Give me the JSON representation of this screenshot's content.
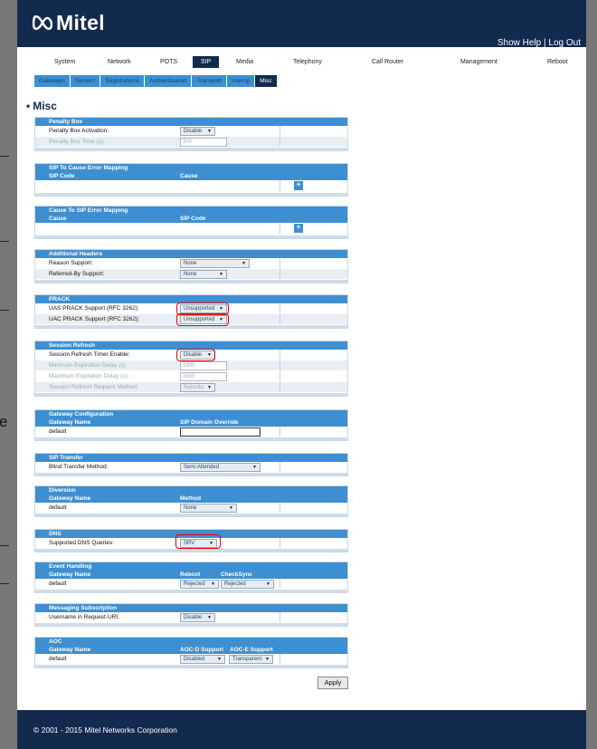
{
  "header": {
    "logo_text": "Mitel",
    "show_help": "Show Help",
    "separator": "|",
    "log_out": "Log Out"
  },
  "nav": {
    "items": [
      "System",
      "Network",
      "POTS",
      "SIP",
      "Media",
      "Telephony",
      "Call Router",
      "Management",
      "Reboot"
    ],
    "active": "SIP"
  },
  "subnav": {
    "items": [
      "Gateways",
      "Servers",
      "Registrations",
      "Authentication",
      "Transport",
      "Interop",
      "Misc"
    ],
    "active": "Misc"
  },
  "page_title": "Misc",
  "sections": {
    "penalty_box": {
      "title": "Penalty Box",
      "activation_label": "Penalty Box Activation:",
      "activation_value": "Disable",
      "time_label": "Penalty Box Time (s):",
      "time_value": "300"
    },
    "sip_to_cause": {
      "title": "SIP To Cause Error Mapping",
      "col1": "SIP Code",
      "col2": "Cause"
    },
    "cause_to_sip": {
      "title": "Cause To SIP Error Mapping",
      "col1": "Cause",
      "col2": "SIP Code"
    },
    "additional_headers": {
      "title": "Additional Headers",
      "reason_label": "Reason Support:",
      "reason_value": "None",
      "referred_label": "Referred-By Support:",
      "referred_value": "None"
    },
    "prack": {
      "title": "PRACK",
      "uas_label": "UAS PRACK Support (RFC 3262):",
      "uas_value": "Unsupported",
      "uac_label": "UAC PRACK Support (RFC 3262):",
      "uac_value": "Unsupported"
    },
    "session_refresh": {
      "title": "Session Refresh",
      "timer_label": "Session Refresh Timer Enable:",
      "timer_value": "Disable",
      "min_label": "Minimum Expiration Delay (s):",
      "min_value": "1800",
      "max_label": "Maximum Expiration Delay (s):",
      "max_value": "3600",
      "method_label": "Session Refresh Request Method:",
      "method_value": "ReInvite"
    },
    "gateway_config": {
      "title": "Gateway Configuration",
      "col1": "Gateway Name",
      "col2": "SIP Domain Override",
      "row_name": "default",
      "row_value": ""
    },
    "sip_transfer": {
      "title": "SIP Transfer",
      "blind_label": "Blind Transfer Method:",
      "blind_value": "Semi Attended"
    },
    "diversion": {
      "title": "Diversion",
      "col1": "Gateway Name",
      "col2": "Method",
      "row_name": "default",
      "row_value": "None"
    },
    "dns": {
      "title": "DNS",
      "queries_label": "Supported DNS Queries:",
      "queries_value": "SRV"
    },
    "event_handling": {
      "title": "Event Handling",
      "col1": "Gateway Name",
      "col2": "Reboot",
      "col3": "CheckSync",
      "row_name": "default",
      "reboot_value": "Rejected",
      "checksync_value": "Rejected"
    },
    "messaging": {
      "title": "Messaging Subscription",
      "username_label": "Username in Request-URI:",
      "username_value": "Disable"
    },
    "aoc": {
      "title": "AOC",
      "col1": "Gateway Name",
      "col2": "AOC-D Support",
      "col3": "AOC-E Support",
      "row_name": "default",
      "aocd_value": "Disabled",
      "aoce_value": "Transparent"
    }
  },
  "apply_label": "Apply",
  "footer_text": "© 2001 - 2015 Mitel Networks Corporation",
  "edge_glyph": "e",
  "colors": {
    "brand_navy": "#132a4f",
    "section_blue": "#3d8fd1",
    "highlight_red": "#e00000"
  }
}
